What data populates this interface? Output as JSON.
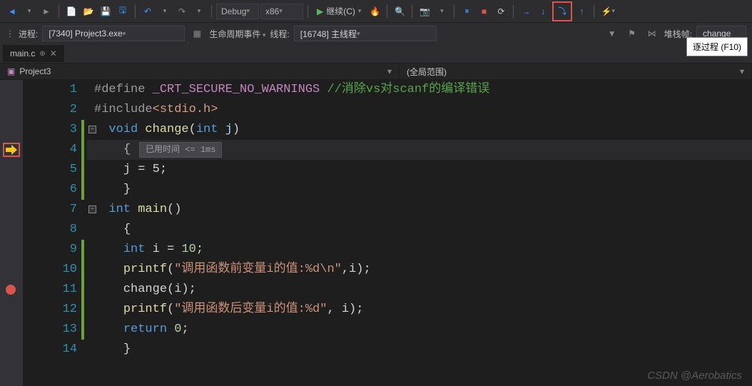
{
  "toolbar": {
    "config": "Debug",
    "platform": "x86",
    "continue_label": "继续(C)",
    "tooltip": "逐过程 (F10)"
  },
  "subbar": {
    "process_label": "进程:",
    "process_value": "[7340] Project3.exe",
    "lifecycle_label": "生命周期事件",
    "thread_label": "线程:",
    "thread_value": "[16748] 主线程",
    "stackframe_label": "堆栈帧:",
    "stackframe_value": "change"
  },
  "tab": {
    "name": "main.c"
  },
  "crumbs": {
    "project": "Project3",
    "scope": "(全局范围)"
  },
  "perf": {
    "elapsed": "已用时间 <= 1ms"
  },
  "lines": {
    "n1": "1",
    "n2": "2",
    "n3": "3",
    "n4": "4",
    "n5": "5",
    "n6": "6",
    "n7": "7",
    "n8": "8",
    "n9": "9",
    "n10": "10",
    "n11": "11",
    "n12": "12",
    "n13": "13",
    "n14": "14"
  },
  "code": {
    "define_kw": "#define ",
    "define_macro": "_CRT_SECURE_NO_WARNINGS",
    "define_comment": " //消除vs对scanf的编译错误",
    "include_kw": "#include",
    "include_file": "<stdio.h>",
    "void_kw": "void",
    "change_fn": "change",
    "int_kw": "int",
    "param_j": "j",
    "brace_open": "{",
    "brace_close": "}",
    "assign_j": "    j = 5;",
    "main_fn": "main",
    "decl_i": "    int i = 10;",
    "printf_fn": "printf",
    "str1": "\"调用函数前变量i的值:%d\\n\"",
    "comma_i": ",i);",
    "call_change": "    change(i);",
    "str2": "\"调用函数后变量i的值:%d\"",
    "comma_i2": ", i);",
    "return_stmt": "    return 0;"
  },
  "watermark": "CSDN @Aerobatics"
}
